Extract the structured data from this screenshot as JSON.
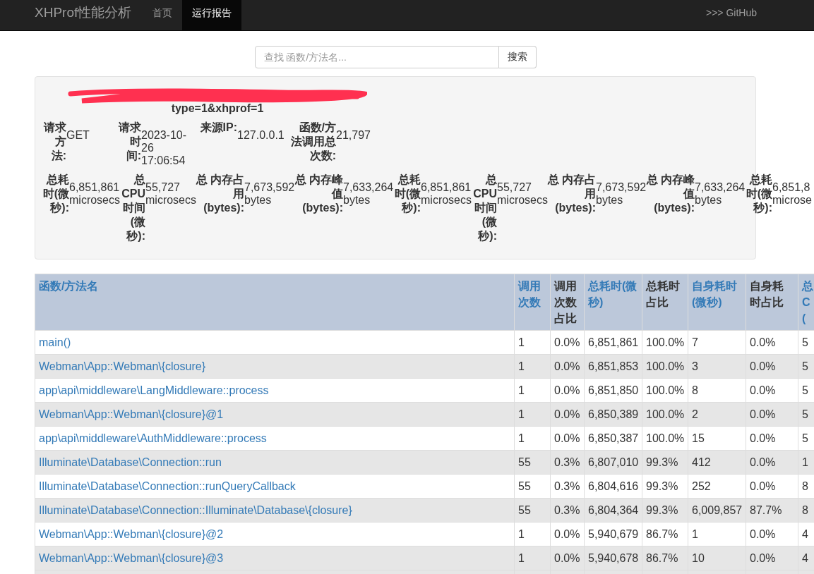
{
  "navbar": {
    "brand": "XHProf性能分析",
    "links": [
      {
        "label": "首页",
        "selected": false
      },
      {
        "label": "运行报告",
        "selected": true
      }
    ],
    "github": ">>> GitHub"
  },
  "search": {
    "placeholder": "查找 函数/方法名...",
    "button": "搜索"
  },
  "summary": {
    "url_tail": "type=1&xhprof=1",
    "rows": [
      [
        {
          "label": "请求方法:",
          "value": "GET"
        },
        {
          "label": "请求时间:",
          "value": "2023-10-26 17:06:54"
        },
        {
          "label": "来源IP:",
          "value": "127.0.0.1"
        },
        {
          "label": "函数/方法调用总次数:",
          "value": "21,797"
        }
      ],
      [
        {
          "label": "总耗时(微秒):",
          "value": "6,851,861 microsecs"
        },
        {
          "label": "总CPU时间(微秒):",
          "value": "55,727 microsecs"
        },
        {
          "label": "总 内存占用(bytes):",
          "value": "7,673,592 bytes"
        },
        {
          "label": "总 内存峰值(bytes):",
          "value": "7,633,264 bytes"
        },
        {
          "label": "总耗时(微秒):",
          "value": "6,851,861 microsecs"
        },
        {
          "label": "总CPU时间(微秒):",
          "value": "55,727 microsecs"
        },
        {
          "label": "总 内存占用(bytes):",
          "value": "7,673,592 bytes"
        },
        {
          "label": "总 内存峰值(bytes):",
          "value": "7,633,264 bytes"
        },
        {
          "label": "总耗时(微秒):",
          "value": "6,851,8 microse"
        }
      ]
    ]
  },
  "table": {
    "columns": [
      {
        "label": "函数/方法名",
        "sortable": true
      },
      {
        "label": "调用次数",
        "sortable": true
      },
      {
        "label": "调用次数占比",
        "sortable": false
      },
      {
        "label": "总耗时(微秒)",
        "sortable": true
      },
      {
        "label": "总耗时占比",
        "sortable": false
      },
      {
        "label": "自身耗时(微秒)",
        "sortable": true
      },
      {
        "label": "自身耗时占比",
        "sortable": false
      },
      {
        "label": "总C(",
        "sortable": true
      }
    ],
    "rows": [
      [
        "main()",
        "1",
        "0.0%",
        "6,851,861",
        "100.0%",
        "7",
        "0.0%",
        "5"
      ],
      [
        "Webman\\App::Webman\\{closure}",
        "1",
        "0.0%",
        "6,851,853",
        "100.0%",
        "3",
        "0.0%",
        "5"
      ],
      [
        "app\\api\\middleware\\LangMiddleware::process",
        "1",
        "0.0%",
        "6,851,850",
        "100.0%",
        "8",
        "0.0%",
        "5"
      ],
      [
        "Webman\\App::Webman\\{closure}@1",
        "1",
        "0.0%",
        "6,850,389",
        "100.0%",
        "2",
        "0.0%",
        "5"
      ],
      [
        "app\\api\\middleware\\AuthMiddleware::process",
        "1",
        "0.0%",
        "6,850,387",
        "100.0%",
        "15",
        "0.0%",
        "5"
      ],
      [
        "Illuminate\\Database\\Connection::run",
        "55",
        "0.3%",
        "6,807,010",
        "99.3%",
        "412",
        "0.0%",
        "1"
      ],
      [
        "Illuminate\\Database\\Connection::runQueryCallback",
        "55",
        "0.3%",
        "6,804,616",
        "99.3%",
        "252",
        "0.0%",
        "8"
      ],
      [
        "Illuminate\\Database\\Connection::Illuminate\\Database\\{closure}",
        "55",
        "0.3%",
        "6,804,364",
        "99.3%",
        "6,009,857",
        "87.7%",
        "8"
      ],
      [
        "Webman\\App::Webman\\{closure}@2",
        "1",
        "0.0%",
        "5,940,679",
        "86.7%",
        "1",
        "0.0%",
        "4"
      ],
      [
        "Webman\\App::Webman\\{closure}@3",
        "1",
        "0.0%",
        "5,940,678",
        "86.7%",
        "10",
        "0.0%",
        "4"
      ]
    ]
  }
}
